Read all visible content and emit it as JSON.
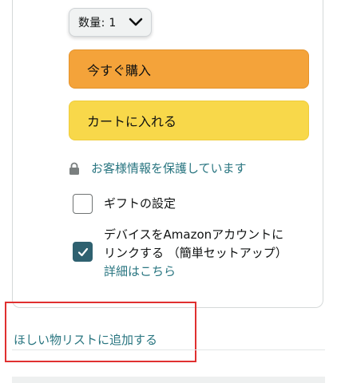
{
  "quantity": {
    "label": "数量: 1"
  },
  "buttons": {
    "buy_now": "今すぐ購入",
    "add_to_cart": "カートに入れる"
  },
  "secure": {
    "text": "お客様情報を保護しています"
  },
  "options": {
    "gift": {
      "label": "ギフトの設定",
      "checked": false
    },
    "device_link": {
      "line1": "デバイスをAmazonアカウントに",
      "line2": "リンクする （簡単セットアップ）",
      "details_link": "詳細はこちら",
      "checked": true
    }
  },
  "wishlist": {
    "label": "ほしい物リストに追加する"
  },
  "colors": {
    "buy_now": "#f4a33a",
    "add_to_cart": "#f8d84a",
    "link": "#2a7681",
    "checkbox_checked": "#2f6170",
    "highlight": "#e03030"
  },
  "icons": {
    "lock": "lock-icon",
    "chevron": "chevron-down-icon",
    "check": "checkmark-icon"
  }
}
